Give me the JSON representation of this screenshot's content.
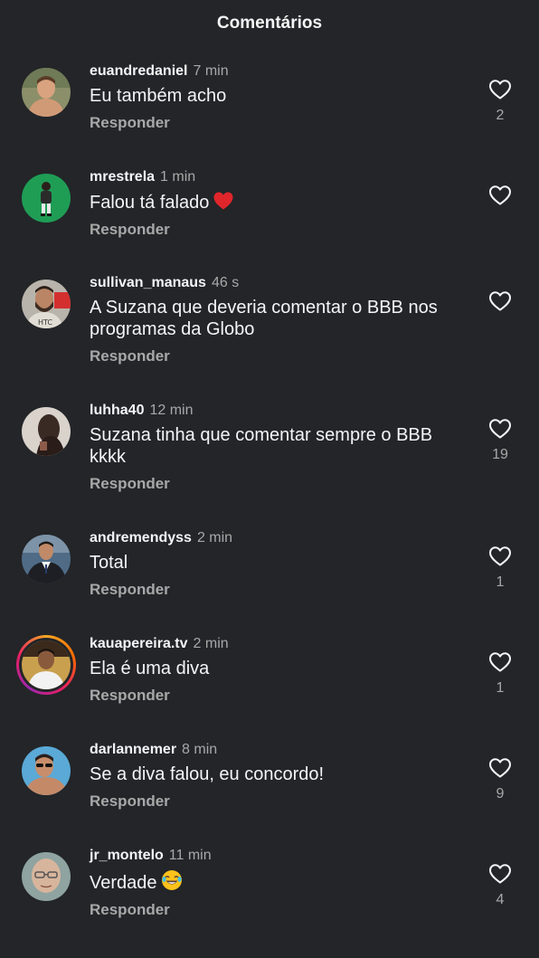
{
  "header": {
    "title": "Comentários"
  },
  "reply_label": "Responder",
  "comments": [
    {
      "username": "euandredaniel",
      "time": "7 min",
      "text": "Eu também acho",
      "likes": "2",
      "avatar": "person-shirtless-avatar"
    },
    {
      "username": "mrestrela",
      "time": "1 min",
      "text": "Falou tá falado",
      "emoji": "red-heart",
      "likes": "",
      "avatar": "person-green-avatar"
    },
    {
      "username": "sullivan_manaus",
      "time": "46 s",
      "text": "A Suzana que deveria comentar o BBB nos programas da Globo",
      "likes": "",
      "avatar": "person-bearded-avatar"
    },
    {
      "username": "luhha40",
      "time": "12 min",
      "text": "Suzana tinha que comentar sempre o BBB kkkk",
      "likes": "19",
      "avatar": "person-dark-avatar"
    },
    {
      "username": "andremendyss",
      "time": "2 min",
      "text": "Total",
      "likes": "1",
      "avatar": "person-suit-avatar"
    },
    {
      "username": "kauapereira.tv",
      "time": "2 min",
      "text": "Ela é uma diva",
      "likes": "1",
      "avatar": "person-story-avatar"
    },
    {
      "username": "darlannemer",
      "time": "8 min",
      "text": "Se a diva falou, eu concordo!",
      "likes": "9",
      "avatar": "person-sunglasses-avatar"
    },
    {
      "username": "jr_montelo",
      "time": "11 min",
      "text": "Verdade",
      "emoji": "laughing-face",
      "likes": "4",
      "avatar": "person-face-avatar"
    }
  ],
  "colors": {
    "background": "#232528",
    "text_primary": "#f3f5f7",
    "text_secondary": "#a8a8a8",
    "heart_red": "#e0262b"
  }
}
